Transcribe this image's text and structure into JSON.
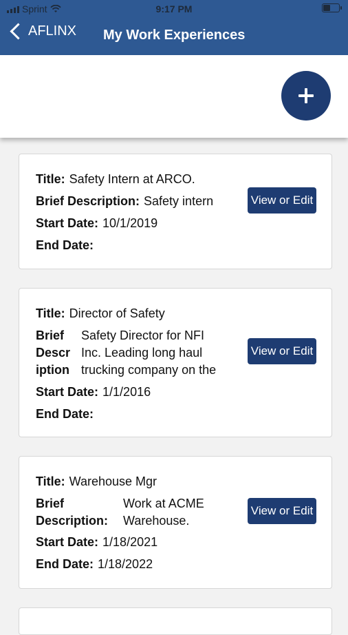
{
  "status_bar": {
    "carrier": "Sprint",
    "time": "9:17 PM"
  },
  "nav": {
    "back_label": "AFLINX",
    "title": "My Work Experiences"
  },
  "labels": {
    "title": "Title:",
    "brief_description": "Brief Description:",
    "brief_col": [
      "Brief",
      "Descr",
      "iption"
    ],
    "brief_two_line": [
      "Brief",
      "Description:"
    ],
    "start_date": "Start Date:",
    "end_date": "End Date:",
    "view_edit": "View or Edit"
  },
  "experiences": [
    {
      "title": "Safety Intern at ARCO.",
      "brief_description": [
        "Safety intern"
      ],
      "start_date": "10/1/2019",
      "end_date": ""
    },
    {
      "title": "Director of Safety",
      "brief_description": [
        "Safety Director for NFI",
        "Inc. Leading long haul",
        "trucking company on the"
      ],
      "start_date": "1/1/2016",
      "end_date": ""
    },
    {
      "title": "Warehouse Mgr",
      "brief_description": [
        "Work at ACME",
        "Warehouse."
      ],
      "start_date": "1/18/2021",
      "end_date": "1/18/2022"
    }
  ],
  "colors": {
    "header": "#2e5993",
    "button": "#1e3c72",
    "background": "#f2f2f2"
  },
  "icons": {
    "back": "chevron-left-icon",
    "add": "plus-icon",
    "wifi": "wifi-icon",
    "signal": "signal-icon",
    "battery": "battery-icon"
  }
}
